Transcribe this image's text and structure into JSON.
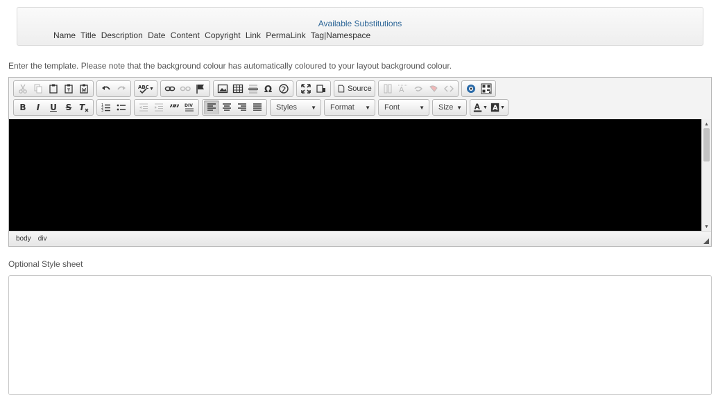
{
  "substitutions": {
    "title": "Available Substitutions",
    "items": [
      "Name",
      "Title",
      "Description",
      "Date",
      "Content",
      "Copyright",
      "Link",
      "PermaLink",
      "Tag|Namespace"
    ]
  },
  "template_hint": "Enter the template. Please note that the background colour has automatically coloured to your layout background colour.",
  "editor": {
    "source_label": "Source",
    "combos": {
      "styles": "Styles",
      "format": "Format",
      "font": "Font",
      "size": "Size"
    },
    "status_path": [
      "body",
      "div"
    ],
    "content_bg": "#000000"
  },
  "stylesheet": {
    "label": "Optional Style sheet",
    "value": ""
  }
}
